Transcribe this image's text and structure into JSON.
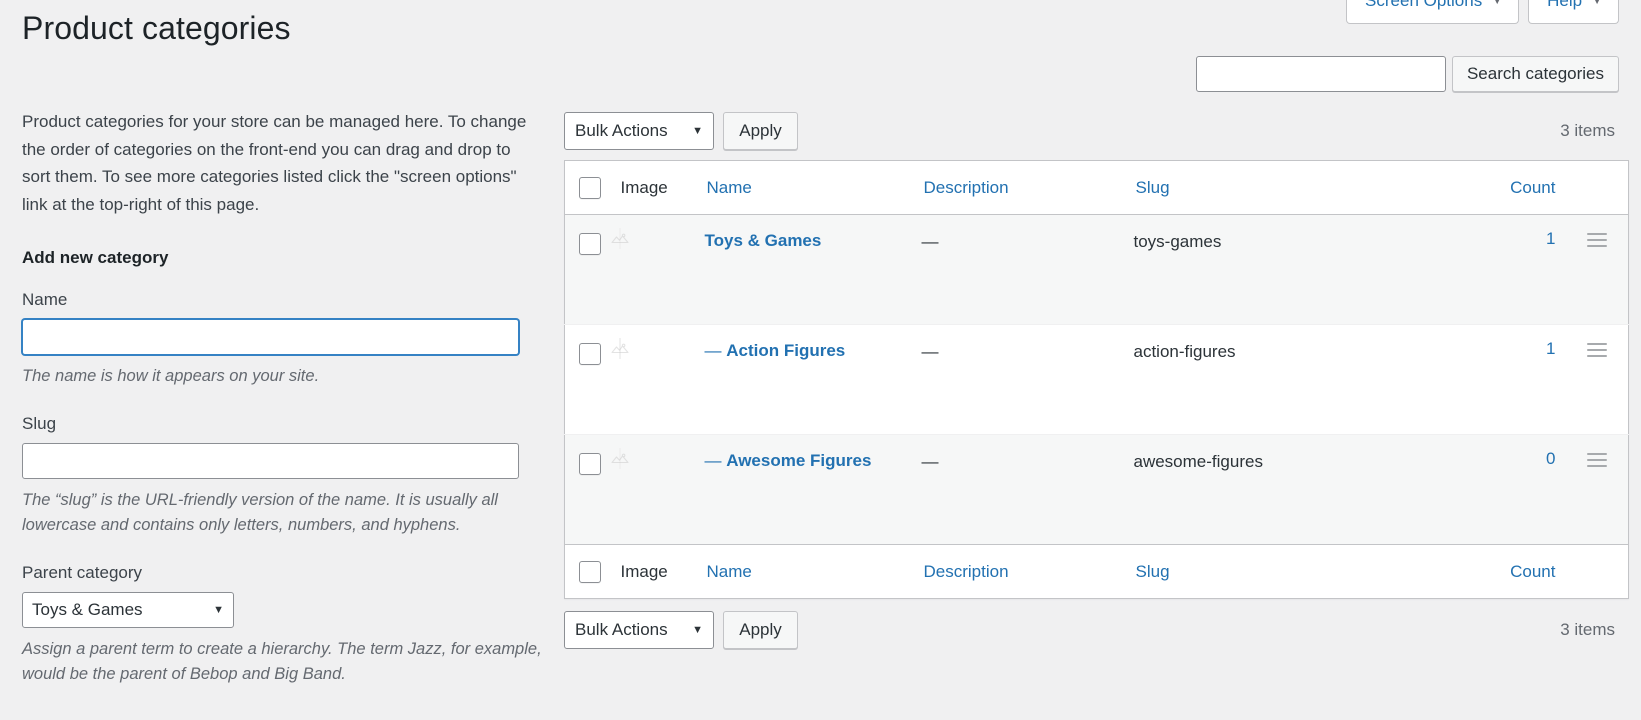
{
  "page": {
    "title": "Product categories"
  },
  "screen_meta": {
    "screen_options_label": "Screen Options",
    "help_label": "Help",
    "caret": "▼"
  },
  "search": {
    "value": "",
    "placeholder": "",
    "button_label": "Search categories"
  },
  "intro": {
    "text": "Product categories for your store can be managed here. To change the order of categories on the front-end you can drag and drop to sort them. To see more categories listed click the \"screen options\" link at the top-right of this page."
  },
  "form": {
    "heading": "Add new category",
    "name_label": "Name",
    "name_value": "",
    "name_description": "The name is how it appears on your site.",
    "slug_label": "Slug",
    "slug_value": "",
    "slug_description": "The “slug” is the URL-friendly version of the name. It is usually all lowercase and contains only letters, numbers, and hyphens.",
    "parent_label": "Parent category",
    "parent_selected": "Toys & Games",
    "parent_description": "Assign a parent term to create a hierarchy. The term Jazz, for example, would be the parent of Bebop and Big Band.",
    "caret": "▼"
  },
  "tablenav": {
    "bulk_actions_label": "Bulk Actions",
    "bulk_caret": "▼",
    "apply_label": "Apply",
    "items_count_top": "3 items",
    "items_count_bottom": "3 items"
  },
  "table": {
    "columns": {
      "image": "Image",
      "name": "Name",
      "description": "Description",
      "slug": "Slug",
      "count": "Count"
    },
    "rows": [
      {
        "name_prefix": "",
        "name": "Toys & Games",
        "description": "—",
        "slug": "toys-games",
        "count": "1",
        "image_alt": "placeholder-thumbnail"
      },
      {
        "name_prefix": "— ",
        "name": "Action Figures",
        "description": "—",
        "slug": "action-figures",
        "count": "1",
        "image_alt": "placeholder-thumbnail"
      },
      {
        "name_prefix": "— ",
        "name": "Awesome Figures",
        "description": "—",
        "slug": "awesome-figures",
        "count": "0",
        "image_alt": "placeholder-thumbnail"
      }
    ]
  },
  "colors": {
    "link": "#2271b1",
    "text": "#3c434a",
    "heading": "#1d2327",
    "page_bg": "#f0f0f1",
    "row_alt_bg": "#f6f7f7",
    "border": "#c3c4c7",
    "focus": "#3582c4"
  }
}
